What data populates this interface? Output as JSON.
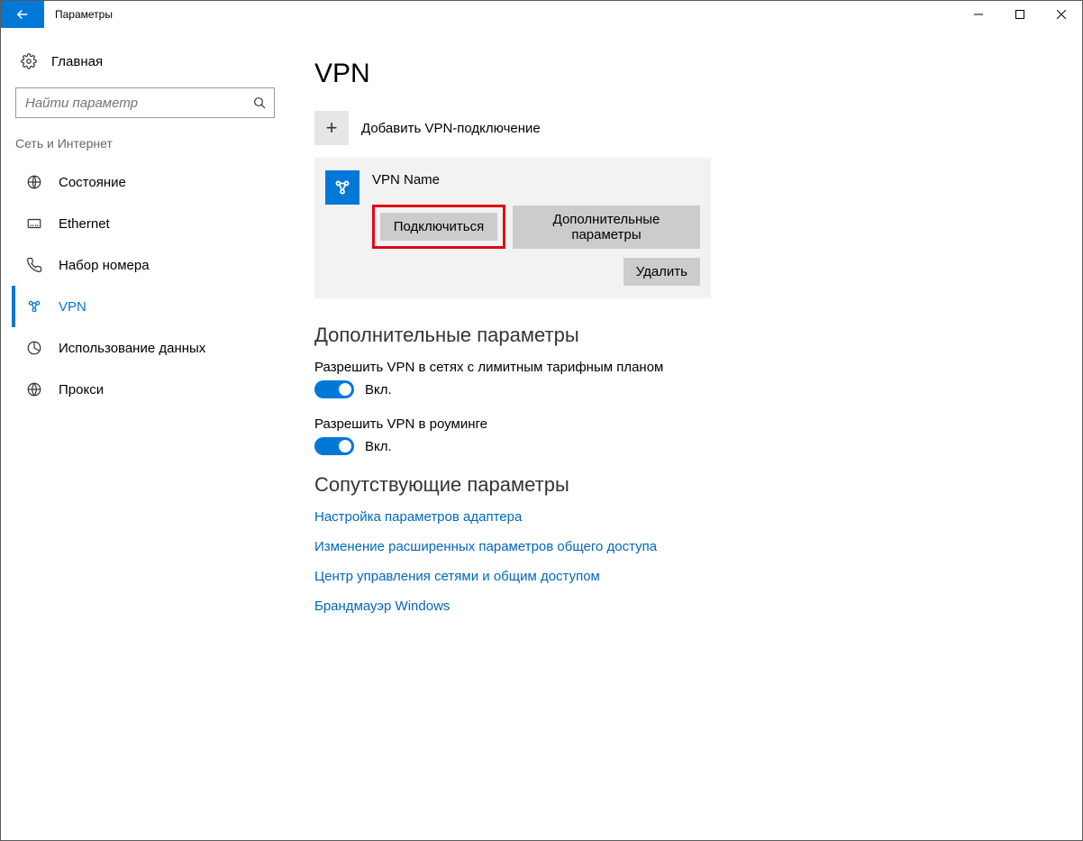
{
  "window": {
    "title": "Параметры"
  },
  "sidebar": {
    "home": "Главная",
    "search_placeholder": "Найти параметр",
    "category": "Сеть и Интернет",
    "items": [
      {
        "label": "Состояние"
      },
      {
        "label": "Ethernet"
      },
      {
        "label": "Набор номера"
      },
      {
        "label": "VPN"
      },
      {
        "label": "Использование данных"
      },
      {
        "label": "Прокси"
      }
    ]
  },
  "main": {
    "title": "VPN",
    "add_vpn": "Добавить VPN-подключение",
    "vpn_item": {
      "name": "VPN Name",
      "connect": "Подключиться",
      "advanced": "Дополнительные параметры",
      "delete": "Удалить"
    },
    "advanced_section": {
      "title": "Дополнительные параметры",
      "metered_label": "Разрешить VPN в сетях с лимитным тарифным планом",
      "metered_state": "Вкл.",
      "roaming_label": "Разрешить VPN в роуминге",
      "roaming_state": "Вкл."
    },
    "related_section": {
      "title": "Сопутствующие параметры",
      "links": [
        "Настройка параметров адаптера",
        "Изменение расширенных параметров общего доступа",
        "Центр управления сетями и общим доступом",
        "Брандмауэр Windows"
      ]
    }
  }
}
